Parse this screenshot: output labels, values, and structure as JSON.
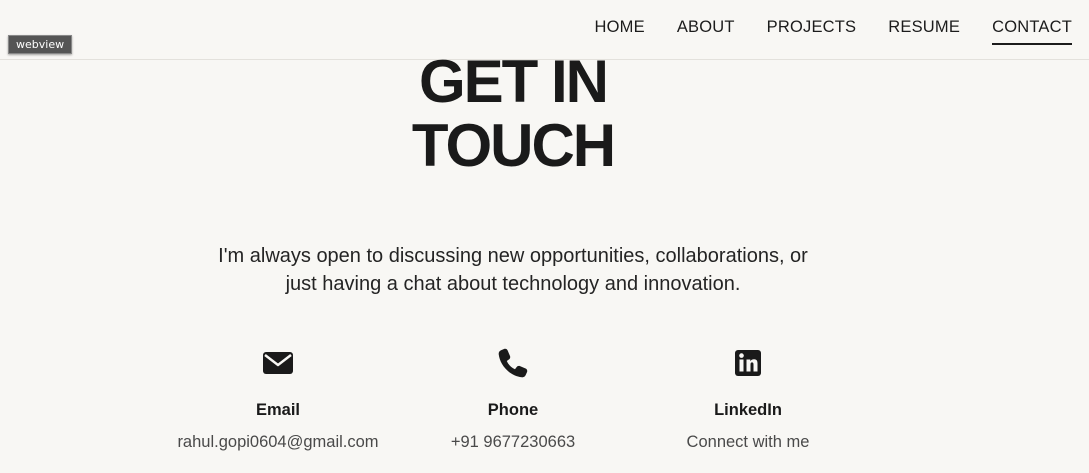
{
  "nav": {
    "items": [
      {
        "label": "HOME",
        "active": false
      },
      {
        "label": "ABOUT",
        "active": false
      },
      {
        "label": "PROJECTS",
        "active": false
      },
      {
        "label": "RESUME",
        "active": false
      },
      {
        "label": "CONTACT",
        "active": true
      }
    ]
  },
  "overlay": {
    "webview_label": "webview"
  },
  "hero": {
    "title_line1": "GET IN",
    "title_line2": "TOUCH"
  },
  "intro": {
    "line1": "I'm always open to discussing new opportunities, collaborations, or",
    "line2": "just having a chat about technology and innovation."
  },
  "contacts": [
    {
      "icon": "envelope-icon",
      "label": "Email",
      "value": "rahul.gopi0604@gmail.com"
    },
    {
      "icon": "phone-icon",
      "label": "Phone",
      "value": "+91 9677230663"
    },
    {
      "icon": "linkedin-icon",
      "label": "LinkedIn",
      "value": "Connect with me"
    }
  ],
  "colors": {
    "background": "#f8f7f4",
    "text": "#1c1c1c",
    "muted": "#4a4a4a",
    "tag_bg": "#555555"
  }
}
